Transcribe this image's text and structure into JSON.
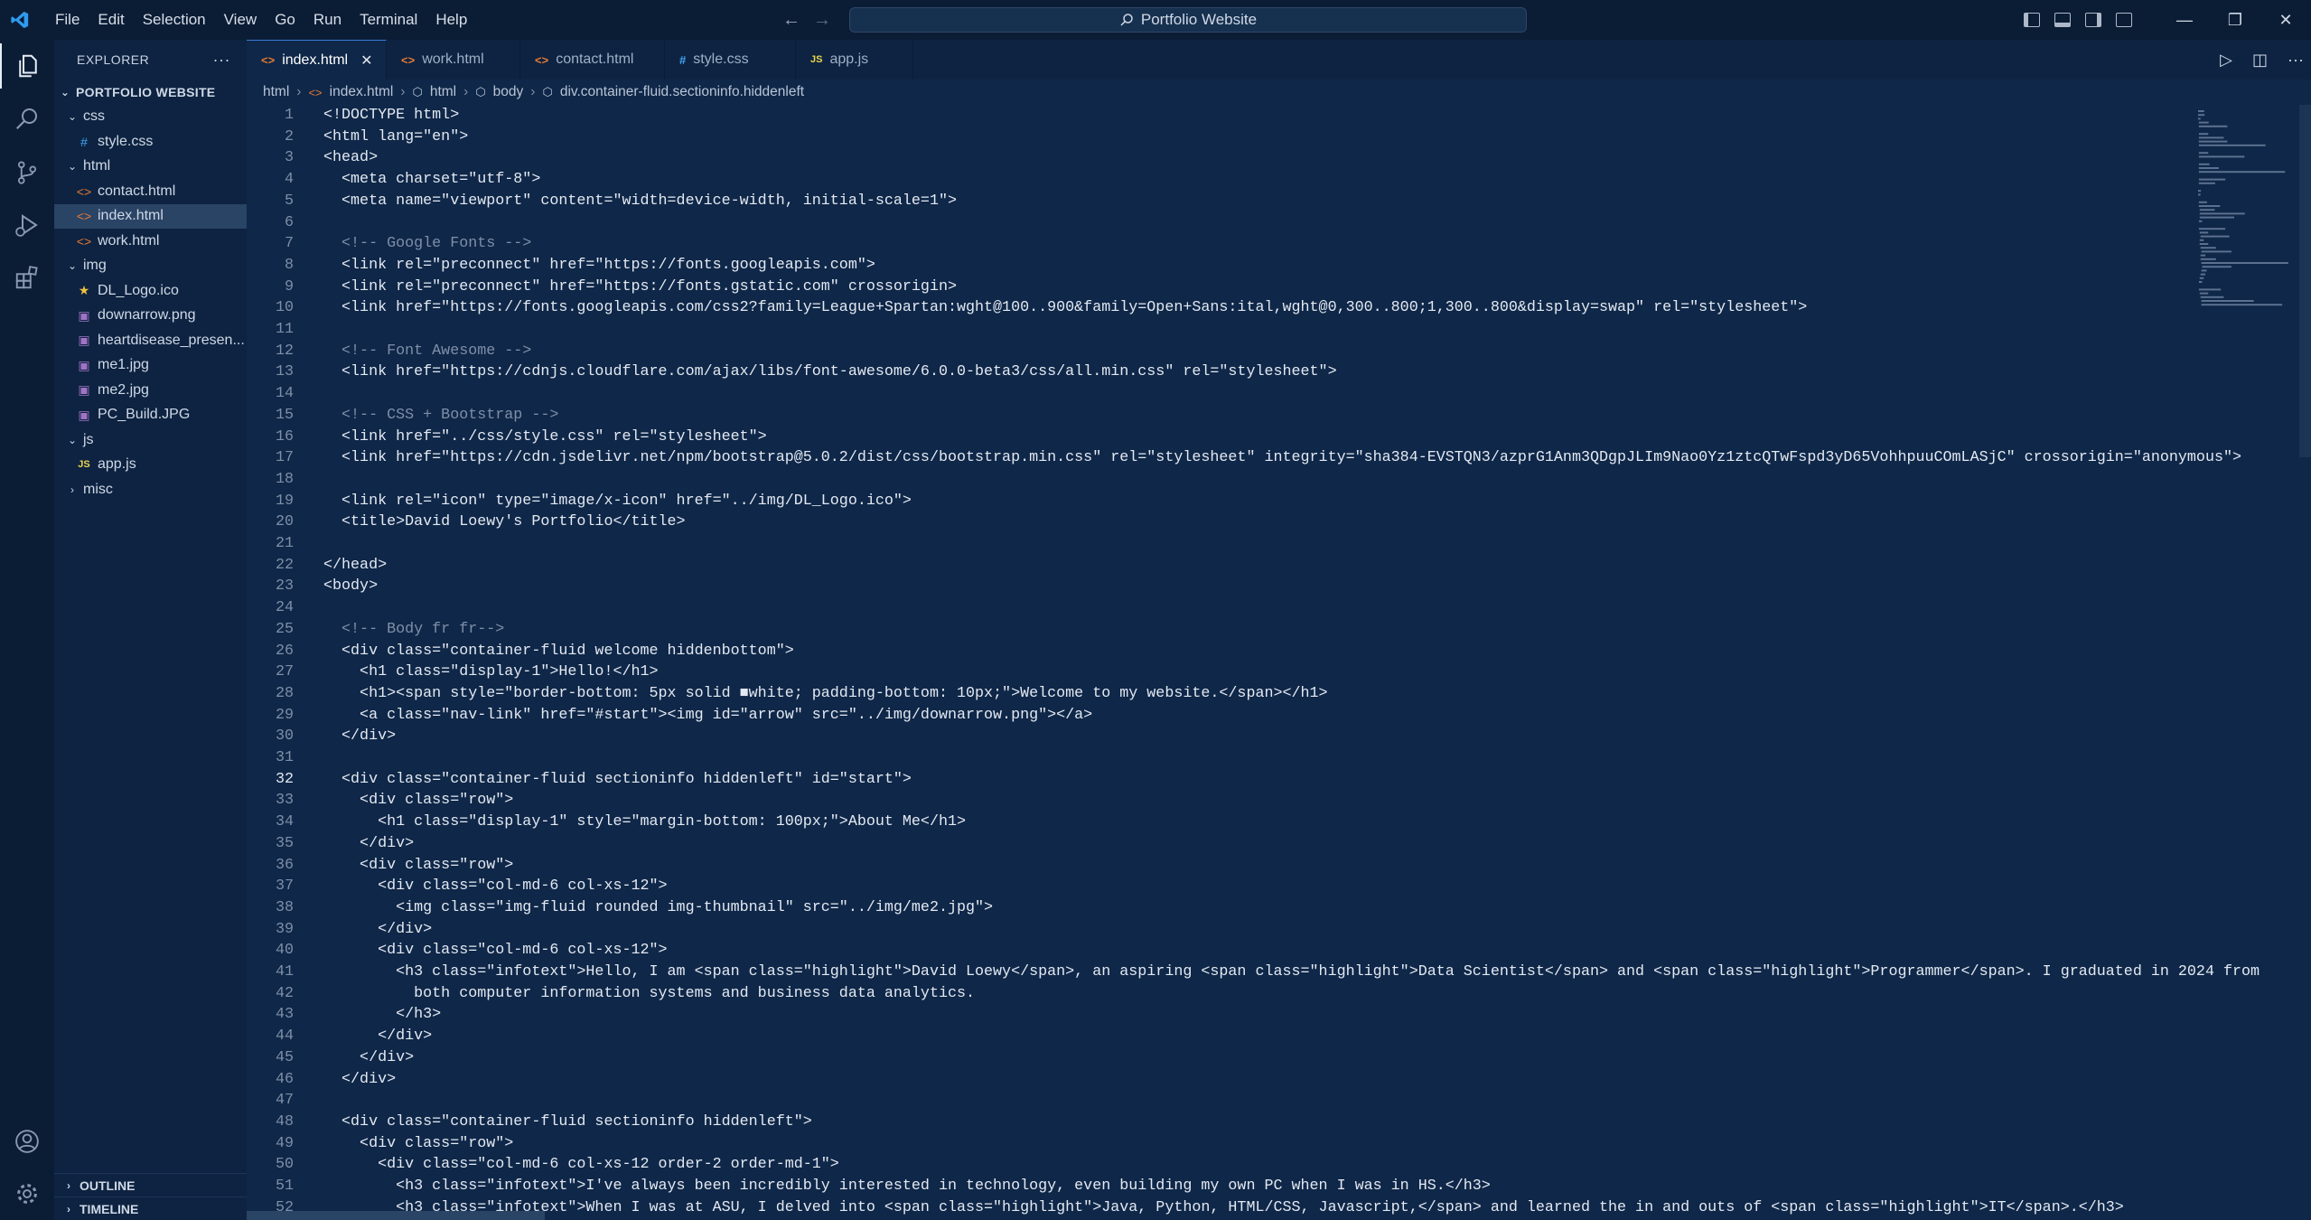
{
  "menu": [
    "File",
    "Edit",
    "Selection",
    "View",
    "Go",
    "Run",
    "Terminal",
    "Help"
  ],
  "search": {
    "label": "Portfolio Website"
  },
  "sidebar": {
    "title": "EXPLORER",
    "more": "···",
    "project": "PORTFOLIO WEBSITE",
    "items": [
      {
        "label": "css",
        "type": "folder",
        "depth": 1,
        "open": true
      },
      {
        "label": "style.css",
        "type": "css",
        "depth": 2
      },
      {
        "label": "html",
        "type": "folder",
        "depth": 1,
        "open": true
      },
      {
        "label": "contact.html",
        "type": "html",
        "depth": 2
      },
      {
        "label": "index.html",
        "type": "html",
        "depth": 2,
        "selected": true
      },
      {
        "label": "work.html",
        "type": "html",
        "depth": 2
      },
      {
        "label": "img",
        "type": "folder",
        "depth": 1,
        "open": true
      },
      {
        "label": "DL_Logo.ico",
        "type": "ico",
        "depth": 2
      },
      {
        "label": "downarrow.png",
        "type": "img",
        "depth": 2
      },
      {
        "label": "heartdisease_presen...",
        "type": "img",
        "depth": 2
      },
      {
        "label": "me1.jpg",
        "type": "img",
        "depth": 2
      },
      {
        "label": "me2.jpg",
        "type": "img",
        "depth": 2
      },
      {
        "label": "PC_Build.JPG",
        "type": "img",
        "depth": 2
      },
      {
        "label": "js",
        "type": "folder",
        "depth": 1,
        "open": true
      },
      {
        "label": "app.js",
        "type": "js",
        "depth": 2
      },
      {
        "label": "misc",
        "type": "folder",
        "depth": 1,
        "open": false
      }
    ],
    "outline": "OUTLINE",
    "timeline": "TIMELINE"
  },
  "tabs": [
    {
      "label": "index.html",
      "icon": "<>",
      "active": true
    },
    {
      "label": "work.html",
      "icon": "<>"
    },
    {
      "label": "contact.html",
      "icon": "<>"
    },
    {
      "label": "style.css",
      "icon": "#"
    },
    {
      "label": "app.js",
      "icon": "JS"
    }
  ],
  "breadcrumb": [
    "html",
    "index.html",
    "html",
    "body",
    "div.container-fluid.sectioninfo.hiddenleft"
  ],
  "lines": [
    {
      "n": "1",
      "t": "<!DOCTYPE html>"
    },
    {
      "n": "2",
      "t": "<html lang=\"en\">"
    },
    {
      "n": "3",
      "t": "<head>"
    },
    {
      "n": "4",
      "t": "  <meta charset=\"utf-8\">"
    },
    {
      "n": "5",
      "t": "  <meta name=\"viewport\" content=\"width=device-width, initial-scale=1\">"
    },
    {
      "n": "6",
      "t": ""
    },
    {
      "n": "7",
      "t": "  <!-- Google Fonts -->"
    },
    {
      "n": "8",
      "t": "  <link rel=\"preconnect\" href=\"https://fonts.googleapis.com\">"
    },
    {
      "n": "9",
      "t": "  <link rel=\"preconnect\" href=\"https://fonts.gstatic.com\" crossorigin>"
    },
    {
      "n": "10",
      "t": "  <link href=\"https://fonts.googleapis.com/css2?family=League+Spartan:wght@100..900&family=Open+Sans:ital,wght@0,300..800;1,300..800&display=swap\" rel=\"stylesheet\">"
    },
    {
      "n": "11",
      "t": ""
    },
    {
      "n": "12",
      "t": "  <!-- Font Awesome -->"
    },
    {
      "n": "13",
      "t": "  <link href=\"https://cdnjs.cloudflare.com/ajax/libs/font-awesome/6.0.0-beta3/css/all.min.css\" rel=\"stylesheet\">"
    },
    {
      "n": "14",
      "t": ""
    },
    {
      "n": "15",
      "t": "  <!-- CSS + Bootstrap -->"
    },
    {
      "n": "16",
      "t": "  <link href=\"../css/style.css\" rel=\"stylesheet\">"
    },
    {
      "n": "17",
      "t": "  <link href=\"https://cdn.jsdelivr.net/npm/bootstrap@5.0.2/dist/css/bootstrap.min.css\" rel=\"stylesheet\" integrity=\"sha384-EVSTQN3/azprG1Anm3QDgpJLIm9Nao0Yz1ztcQTwFspd3yD65VohhpuuCOmLASjC\" crossorigin=\"anonymous\">"
    },
    {
      "n": "18",
      "t": ""
    },
    {
      "n": "19",
      "t": "  <link rel=\"icon\" type=\"image/x-icon\" href=\"../img/DL_Logo.ico\">"
    },
    {
      "n": "20",
      "t": "  <title>David Loewy's Portfolio</title>"
    },
    {
      "n": "21",
      "t": ""
    },
    {
      "n": "22",
      "t": "</head>"
    },
    {
      "n": "23",
      "t": "<body>"
    },
    {
      "n": "24",
      "t": ""
    },
    {
      "n": "25",
      "t": "  <!-- Body fr fr-->"
    },
    {
      "n": "26",
      "t": "  <div class=\"container-fluid welcome hiddenbottom\">"
    },
    {
      "n": "27",
      "t": "    <h1 class=\"display-1\">Hello!</h1>"
    },
    {
      "n": "28",
      "t": "    <h1><span style=\"border-bottom: 5px solid ■white; padding-bottom: 10px;\">Welcome to my website.</span></h1>"
    },
    {
      "n": "29",
      "t": "    <a class=\"nav-link\" href=\"#start\"><img id=\"arrow\" src=\"../img/downarrow.png\"></a>"
    },
    {
      "n": "30",
      "t": "  </div>"
    },
    {
      "n": "31",
      "t": ""
    },
    {
      "n": "32",
      "t": "  <div class=\"container-fluid sectioninfo hiddenleft\" id=\"start\">"
    },
    {
      "n": "33",
      "t": "    <div class=\"row\">"
    },
    {
      "n": "34",
      "t": "      <h1 class=\"display-1\" style=\"margin-bottom: 100px;\">About Me</h1>"
    },
    {
      "n": "35",
      "t": "    </div>"
    },
    {
      "n": "36",
      "t": "    <div class=\"row\">"
    },
    {
      "n": "37",
      "t": "      <div class=\"col-md-6 col-xs-12\">"
    },
    {
      "n": "38",
      "t": "        <img class=\"img-fluid rounded img-thumbnail\" src=\"../img/me2.jpg\">"
    },
    {
      "n": "39",
      "t": "      </div>"
    },
    {
      "n": "40",
      "t": "      <div class=\"col-md-6 col-xs-12\">"
    },
    {
      "n": "41",
      "t": "        <h3 class=\"infotext\">Hello, I am <span class=\"highlight\">David Loewy</span>, an aspiring <span class=\"highlight\">Data Scientist</span> and <span class=\"highlight\">Programmer</span>. I graduated in 2024 from"
    },
    {
      "n": "42",
      "t": "          both computer information systems and business data analytics."
    },
    {
      "n": "43",
      "t": "        </h3>"
    },
    {
      "n": "44",
      "t": "      </div>"
    },
    {
      "n": "45",
      "t": "    </div>"
    },
    {
      "n": "46",
      "t": "  </div>"
    },
    {
      "n": "47",
      "t": ""
    },
    {
      "n": "48",
      "t": "  <div class=\"container-fluid sectioninfo hiddenleft\">"
    },
    {
      "n": "49",
      "t": "    <div class=\"row\">"
    },
    {
      "n": "50",
      "t": "      <div class=\"col-md-6 col-xs-12 order-2 order-md-1\">"
    },
    {
      "n": "51",
      "t": "        <h3 class=\"infotext\">I've always been incredibly interested in technology, even building my own PC when I was in HS.</h3>"
    },
    {
      "n": "52",
      "t": "        <h3 class=\"infotext\">When I was at ASU, I delved into <span class=\"highlight\">Java, Python, HTML/CSS, Javascript,</span> and learned the in and outs of <span class=\"highlight\">IT</span>.</h3>"
    }
  ]
}
